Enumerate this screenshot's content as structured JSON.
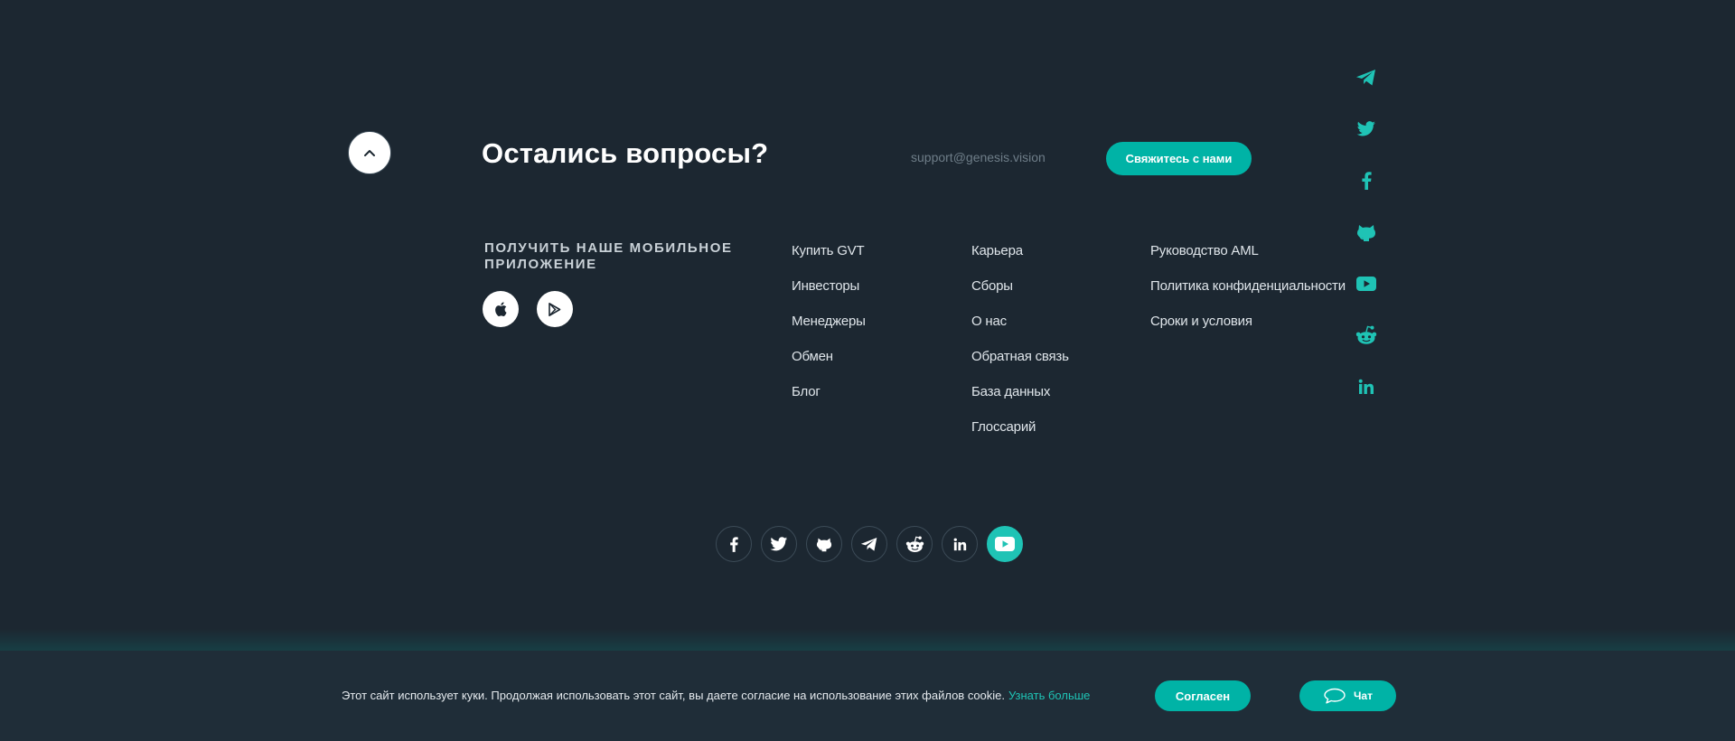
{
  "contact": {
    "title": "Остались вопросы?",
    "email": "support@genesis.vision",
    "button_label": "Свяжитесь с нами"
  },
  "app": {
    "heading": "Получить наше мобильное приложение",
    "apple_icon": "apple-icon",
    "play_icon": "google-play-icon"
  },
  "links": {
    "col1": [
      "Купить GVT",
      "Инвесторы",
      "Менеджеры",
      "Обмен",
      "Блог"
    ],
    "col2": [
      "Карьера",
      "Сборы",
      "О нас",
      "Обратная связь",
      "База данных",
      "Глоссарий"
    ],
    "col3": [
      "Руководство AML",
      "Политика конфиденциальности",
      "Сроки и условия"
    ]
  },
  "side_social": [
    "telegram-icon",
    "twitter-icon",
    "facebook-icon",
    "github-icon",
    "youtube-icon",
    "reddit-icon",
    "linkedin-icon"
  ],
  "bottom_social": [
    "facebook-icon",
    "twitter-icon",
    "github-icon",
    "telegram-icon",
    "reddit-icon",
    "linkedin-icon",
    "youtube-icon"
  ],
  "cookie": {
    "text": "Этот сайт использует куки. Продолжая использовать этот сайт, вы даете согласие на использование этих файлов cookie.",
    "link": "Узнать больше",
    "agree": "Согласен",
    "chat": "Чат"
  },
  "colors": {
    "background": "#1c2731",
    "accent": "#00b3a6",
    "cookie_bar": "#1f2d38"
  }
}
